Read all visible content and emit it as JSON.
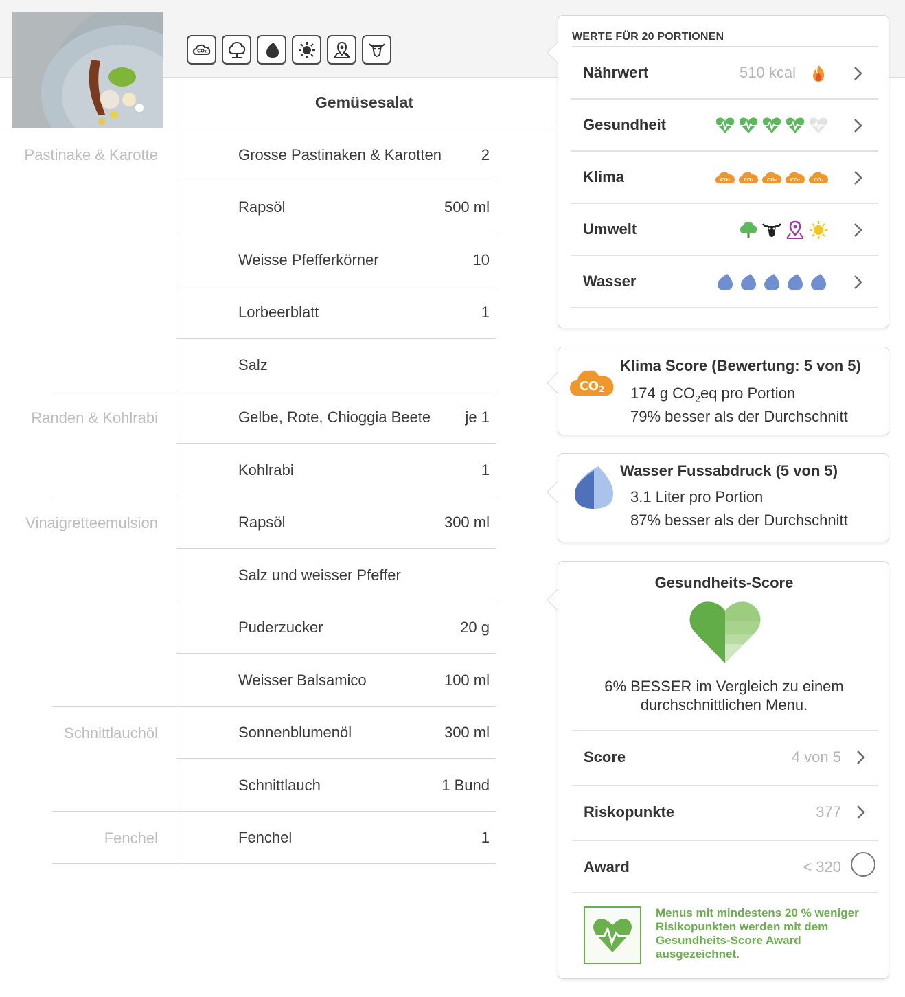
{
  "recipe": {
    "title": "Gemüsesalat",
    "image_alt": "Gemüsesalat auf Teller"
  },
  "toolbar": {
    "icons": [
      "co2-icon",
      "tree-icon",
      "water-drop-icon",
      "sun-icon",
      "map-pin-icon",
      "cow-icon"
    ]
  },
  "groups": [
    {
      "name": "Pastinake & Karotte"
    },
    {
      "name": "Randen & Kohlrabi"
    },
    {
      "name": "Vinaigretteemulsion"
    },
    {
      "name": "Schnittlauchöl"
    },
    {
      "name": "Fenchel"
    }
  ],
  "ingredients": [
    {
      "name": "Grosse Pastinaken & Karotten",
      "qty": "2"
    },
    {
      "name": "Rapsöl",
      "qty": "500 ml"
    },
    {
      "name": "Weisse Pfefferkörner",
      "qty": "10"
    },
    {
      "name": "Lorbeerblatt",
      "qty": "1"
    },
    {
      "name": "Salz",
      "qty": ""
    },
    {
      "name": "Gelbe, Rote, Chioggia Beete",
      "qty": "je 1"
    },
    {
      "name": "Kohlrabi",
      "qty": "1"
    },
    {
      "name": "Rapsöl",
      "qty": "300 ml"
    },
    {
      "name": "Salz und weisser Pfeffer",
      "qty": ""
    },
    {
      "name": "Puderzucker",
      "qty": "20 g"
    },
    {
      "name": "Weisser Balsamico",
      "qty": "100 ml"
    },
    {
      "name": "Sonnenblumenöl",
      "qty": "300 ml"
    },
    {
      "name": "Schnittlauch",
      "qty": "1 Bund"
    },
    {
      "name": "Fenchel",
      "qty": "1"
    }
  ],
  "values_card": {
    "header": "WERTE FÜR 20 PORTIONEN",
    "rows": [
      {
        "label": "Nährwert",
        "value": "510 kcal",
        "icon": "flame-icon"
      },
      {
        "label": "Gesundheit",
        "value": "",
        "rating": 4,
        "of": 5,
        "icon": "heart-pulse-icon"
      },
      {
        "label": "Klima",
        "value": "",
        "rating": 5,
        "of": 5,
        "icon": "co2-cloud-icon"
      },
      {
        "label": "Umwelt",
        "value": "",
        "icons": [
          "tree-icon",
          "cow-icon",
          "map-pin-icon",
          "sun-icon"
        ]
      },
      {
        "label": "Wasser",
        "value": "",
        "rating": 5,
        "of": 5,
        "icon": "water-drop-icon"
      }
    ]
  },
  "klima_score": {
    "title": "Klima Score (Bewertung: 5 von 5)",
    "line1_pre": "174 g CO",
    "line1_sub": "2",
    "line1_post": "eq pro Portion",
    "line2": "79% besser als der Durchschnitt",
    "badge_text": "CO",
    "badge_sub": "2"
  },
  "wasser_score": {
    "title": "Wasser Fussabdruck (5 von 5)",
    "line1": "3.1 Liter pro Portion",
    "line2": "87% besser als der Durchschnitt"
  },
  "health_score": {
    "title": "Gesundheits-Score",
    "description": "6% BESSER im Vergleich zu einem durchschnittlichen Menu.",
    "rows": [
      {
        "label": "Score",
        "value": "4 von 5"
      },
      {
        "label": "Riskopunkte",
        "value": "377"
      },
      {
        "label": "Award",
        "value": "< 320"
      }
    ],
    "award_note": "Menus mit mindestens 20 % weniger Risikopunkten werden mit dem Gesundheits-Score Award ausgezeichnet."
  },
  "colors": {
    "green": "#5cb85c",
    "orange": "#f0962a",
    "blue": "#6f8fd0",
    "award_green": "#6ab04c",
    "muted": "#bdbdbd"
  }
}
